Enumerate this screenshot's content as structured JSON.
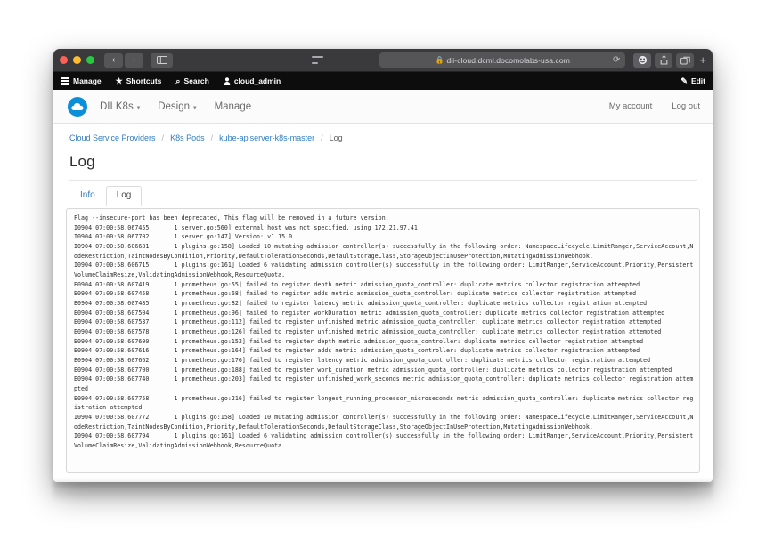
{
  "browser": {
    "traffic_lights": [
      "close",
      "minimize",
      "maximize"
    ],
    "back_label": "‹",
    "forward_label": "›",
    "sidebar_icon": "sidebar-icon",
    "reader_icon": "reader-view-icon",
    "lock_icon": "lock-icon",
    "url": "dii-cloud.dcml.docomolabs-usa.com",
    "reload_label": "⟳",
    "toolbar_icons": [
      "extension-icon",
      "share-icon",
      "tabs-overview-icon"
    ],
    "new_tab_label": "+"
  },
  "appbar": {
    "items": [
      {
        "label": "Manage",
        "icon": "hamburger-icon"
      },
      {
        "label": "Shortcuts",
        "icon": "star-icon",
        "glyph": "★"
      },
      {
        "label": "Search",
        "icon": "search-icon",
        "glyph": "⌕"
      },
      {
        "label": "cloud_admin",
        "icon": "user-icon",
        "glyph": "👤"
      }
    ],
    "edit": {
      "label": "Edit",
      "icon": "pencil-icon",
      "glyph": "✎"
    }
  },
  "header": {
    "logo": "cloud-logo",
    "nav": [
      {
        "label": "DII K8s",
        "has_caret": true
      },
      {
        "label": "Design",
        "has_caret": true
      },
      {
        "label": "Manage",
        "has_caret": false
      }
    ],
    "account_links": [
      {
        "label": "My account"
      },
      {
        "label": "Log out"
      }
    ]
  },
  "breadcrumb": [
    {
      "label": "Cloud Service Providers",
      "current": false
    },
    {
      "label": "K8s Pods",
      "current": false
    },
    {
      "label": "kube-apiserver-k8s-master",
      "current": false
    },
    {
      "label": "Log",
      "current": true
    }
  ],
  "breadcrumb_separator": "/",
  "page": {
    "title": "Log"
  },
  "tabs": [
    {
      "label": "Info",
      "active": false
    },
    {
      "label": "Log",
      "active": true
    }
  ],
  "log": {
    "text": "Flag --insecure-port has been deprecated, This flag will be removed in a future version.\nI0904 07:00:58.067455       1 server.go:560] external host was not specified, using 172.21.97.41\nI0904 07:00:58.067702       1 server.go:147] Version: v1.15.0\nI0904 07:00:58.606681       1 plugins.go:158] Loaded 10 mutating admission controller(s) successfully in the following order: NamespaceLifecycle,LimitRanger,ServiceAccount,NodeRestriction,TaintNodesByCondition,Priority,DefaultTolerationSeconds,DefaultStorageClass,StorageObjectInUseProtection,MutatingAdmissionWebhook.\nI0904 07:00:58.606715       1 plugins.go:161] Loaded 6 validating admission controller(s) successfully in the following order: LimitRanger,ServiceAccount,Priority,PersistentVolumeClaimResize,ValidatingAdmissionWebhook,ResourceQuota.\nE0904 07:00:58.607419       1 prometheus.go:55] failed to register depth metric admission_quota_controller: duplicate metrics collector registration attempted\nE0904 07:00:58.607458       1 prometheus.go:68] failed to register adds metric admission_quota_controller: duplicate metrics collector registration attempted\nE0904 07:00:58.607485       1 prometheus.go:82] failed to register latency metric admission_quota_controller: duplicate metrics collector registration attempted\nE0904 07:00:58.607504       1 prometheus.go:96] failed to register workDuration metric admission_quota_controller: duplicate metrics collector registration attempted\nE0904 07:00:58.607537       1 prometheus.go:112] failed to register unfinished metric admission_quota_controller: duplicate metrics collector registration attempted\nE0904 07:00:58.607578       1 prometheus.go:126] failed to register unfinished metric admission_quota_controller: duplicate metrics collector registration attempted\nE0904 07:00:58.607600       1 prometheus.go:152] failed to register depth metric admission_quota_controller: duplicate metrics collector registration attempted\nE0904 07:00:58.607616       1 prometheus.go:164] failed to register adds metric admission_quota_controller: duplicate metrics collector registration attempted\nE0904 07:00:58.607662       1 prometheus.go:176] failed to register latency metric admission_quota_controller: duplicate metrics collector registration attempted\nE0904 07:00:58.607700       1 prometheus.go:188] failed to register work_duration metric admission_quota_controller: duplicate metrics collector registration attempted\nE0904 07:00:58.607740       1 prometheus.go:203] failed to register unfinished_work_seconds metric admission_quota_controller: duplicate metrics collector registration attempted\nE0904 07:00:58.607758       1 prometheus.go:216] failed to register longest_running_processor_microseconds metric admission_quota_controller: duplicate metrics collector registration attempted\nI0904 07:00:58.607772       1 plugins.go:158] Loaded 10 mutating admission controller(s) successfully in the following order: NamespaceLifecycle,LimitRanger,ServiceAccount,NodeRestriction,TaintNodesByCondition,Priority,DefaultTolerationSeconds,DefaultStorageClass,StorageObjectInUseProtection,MutatingAdmissionWebhook.\nI0904 07:00:58.607794       1 plugins.go:161] Loaded 6 validating admission controller(s) successfully in the following order: LimitRanger,ServiceAccount,Priority,PersistentVolumeClaimResize,ValidatingAdmissionWebhook,ResourceQuota."
  },
  "colors": {
    "accent_link": "#2f7dc4",
    "logo_blue": "#0a8fd8",
    "appbar_black": "#0d0d0d",
    "titlebar_gray": "#3a3a3c"
  }
}
